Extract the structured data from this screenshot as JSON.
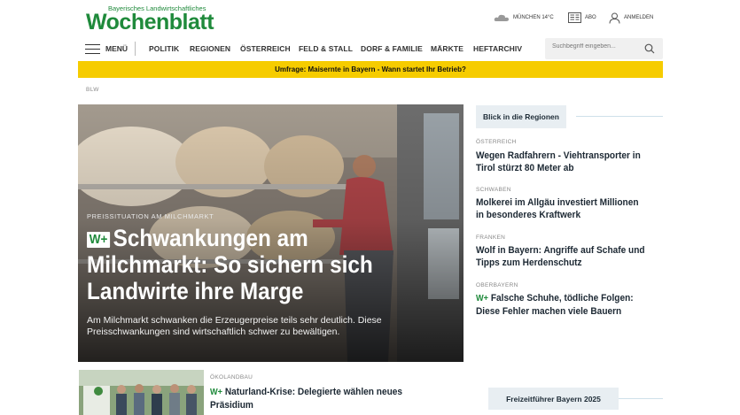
{
  "logo": {
    "tagline": "Bayerisches Landwirtschaftliches",
    "wordmark": "Wochenblatt"
  },
  "utility": {
    "weather": "MÜNCHEN 14°C",
    "abo": "ABO",
    "login": "ANMELDEN"
  },
  "nav": {
    "menu_label": "MENÜ",
    "items": [
      "POLITIK",
      "REGIONEN",
      "ÖSTERREICH",
      "FELD & STALL",
      "DORF & FAMILIE",
      "MÄRKTE",
      "HEFTARCHIV"
    ],
    "search_placeholder": "Suchbegriff eingeben..."
  },
  "banner": {
    "text": "Umfrage: Maisernte in Bayern - Wann startet Ihr Betrieb?"
  },
  "breadcrumb": "BLW",
  "hero": {
    "kicker": "PREISSITUATION AM MILCHMARKT",
    "badge": "W+",
    "headline": "Schwankungen am Milchmarkt: So sichern sich Landwirte ihre Marge",
    "teaser": "Am Milchmarkt schwanken die Erzeugerpreise teils sehr deutlich. Diese Preisschwankungen sind wirtschaftlich schwer zu bewältigen."
  },
  "sidebar": {
    "title": "Blick in die Regionen",
    "stories": [
      {
        "region": "ÖSTERREICH",
        "title": "Wegen Radfahrern - Viehtransporter in Tirol stürzt 80 Meter ab",
        "premium": false
      },
      {
        "region": "SCHWABEN",
        "title": "Molkerei im Allgäu investiert Millionen in besonderes Kraftwerk",
        "premium": false
      },
      {
        "region": "FRANKEN",
        "title": "Wolf in Bayern: Angriffe auf Schafe und Tipps zum Herdenschutz",
        "premium": false
      },
      {
        "region": "OBERBAYERN",
        "title": "Falsche Schuhe, tödliche Folgen: Diese Fehler machen viele Bauern",
        "premium": true,
        "badge": "W+"
      }
    ]
  },
  "bottom_article": {
    "kicker": "ÖKOLANDBAU",
    "badge": "W+",
    "title": "Naturland-Krise: Delegierte wählen neues Präsidium"
  },
  "promo": {
    "label": "Freizeitführer Bayern 2025"
  },
  "colors": {
    "brand_green": "#1f8a3b",
    "banner_yellow": "#f6cc00",
    "label_bg": "#e8eef2"
  }
}
